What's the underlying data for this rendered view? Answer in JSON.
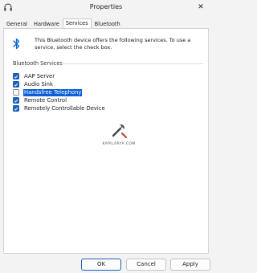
{
  "window": {
    "title": "Properties",
    "close_label": "✕"
  },
  "tabs": [
    {
      "label": "General",
      "active": false
    },
    {
      "label": "Hardware",
      "active": false
    },
    {
      "label": "Services",
      "active": true
    },
    {
      "label": "Bluetooth",
      "active": false
    }
  ],
  "description": "This Bluetooth device offers the following services. To use a service, select the check box.",
  "group_label": "Bluetooth Services",
  "services": [
    {
      "label": "AAP Server",
      "checked": true,
      "selected": false
    },
    {
      "label": "Audio Sink",
      "checked": true,
      "selected": false
    },
    {
      "label": "Handsfree Telephony",
      "checked": false,
      "selected": true
    },
    {
      "label": "Remote Control",
      "checked": true,
      "selected": false
    },
    {
      "label": "Remotely Controllable Device",
      "checked": true,
      "selected": false
    }
  ],
  "watermark": {
    "text": "KAPILARYA.COM"
  },
  "buttons": {
    "ok": "OK",
    "cancel": "Cancel",
    "apply": "Apply"
  },
  "colors": {
    "accent": "#1d5fb4",
    "selection": "#0b5ed7",
    "bluetooth": "#0a66d6"
  },
  "icons": {
    "title": "headphones-icon",
    "device": "bluetooth-icon",
    "watermark": "wrench-icon"
  }
}
